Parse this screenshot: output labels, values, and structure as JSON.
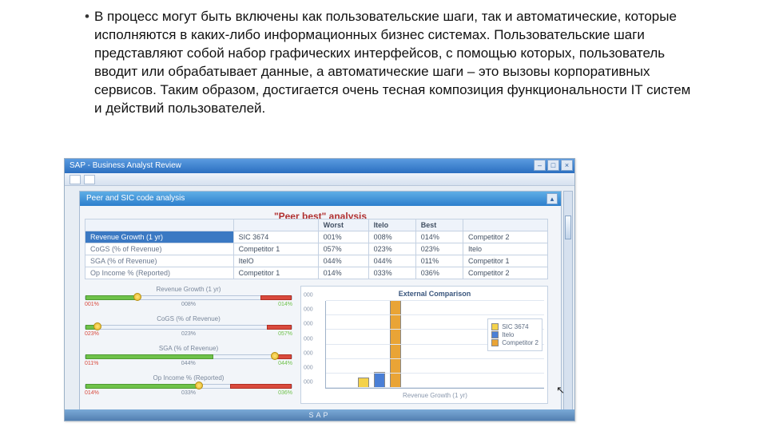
{
  "bullet_text": "В процесс могут быть включены как пользовательские шаги, так и автоматические, которые исполняются в каких-либо информационных бизнес системах. Пользовательские шаги представляют собой набор графических интерфейсов, с помощью которых, пользователь вводит или обрабатывает данные, а автоматические шаги – это вызовы корпоративных сервисов. Таким образом, достигается очень тесная композиция функциональности IT систем и действий пользователей.",
  "window": {
    "title": "SAP - Business Analyst Review",
    "panel_header": "Peer and SIC code analysis",
    "subtitle": "\"Peer best\" analysis",
    "footer": "SAP"
  },
  "table": {
    "headers": [
      "",
      "",
      "Worst",
      "Itelo",
      "Best",
      ""
    ],
    "rows": [
      {
        "metric": "Revenue Growth (1 yr)",
        "who": "SIC 3674",
        "worst": "001%",
        "itelo": "008%",
        "best": "014%",
        "bestname": "Competitor 2",
        "hl": true
      },
      {
        "metric": "CoGS (% of Revenue)",
        "who": "Competitor 1",
        "worst": "057%",
        "itelo": "023%",
        "best": "023%",
        "bestname": "Itelo"
      },
      {
        "metric": "SGA (% of Revenue)",
        "who": "ItelO",
        "worst": "044%",
        "itelo": "044%",
        "best": "011%",
        "bestname": "Competitor 1"
      },
      {
        "metric": "Op Income % (Reported)",
        "who": "Competitor 1",
        "worst": "014%",
        "itelo": "033%",
        "best": "036%",
        "bestname": "Competitor 2"
      }
    ]
  },
  "sliders": [
    {
      "label": "Revenue Growth (1 yr)",
      "left": "001%",
      "mid": "008%",
      "right": "014%",
      "green_w": 25,
      "red_l": 85,
      "knob": 25
    },
    {
      "label": "CoGS (% of Revenue)",
      "left": "023%",
      "mid": "023%",
      "right": "057%",
      "green_w": 6,
      "red_l": 88,
      "knob": 6
    },
    {
      "label": "SGA (% of Revenue)",
      "left": "011%",
      "mid": "044%",
      "right": "044%",
      "green_w": 62,
      "red_l": 92,
      "knob": 92
    },
    {
      "label": "Op Income % (Reported)",
      "left": "014%",
      "mid": "033%",
      "right": "036%",
      "green_w": 55,
      "red_l": 70,
      "knob": 55
    }
  ],
  "chart_data": {
    "type": "bar",
    "title": "External Comparison",
    "xlabel": "Revenue Growth (1 yr)",
    "ylabel": "",
    "ylim": [
      0,
      0.06
    ],
    "yticks": [
      "000",
      "000",
      "000",
      "000",
      "000",
      "000",
      "000"
    ],
    "series": [
      {
        "name": "SIC 3674",
        "color": "#f4d24a",
        "value": 0.007
      },
      {
        "name": "Itelo",
        "color": "#4a7fd6",
        "value": 0.011
      },
      {
        "name": "Competitor 2",
        "color": "#e9a436",
        "value": 0.06
      }
    ]
  }
}
